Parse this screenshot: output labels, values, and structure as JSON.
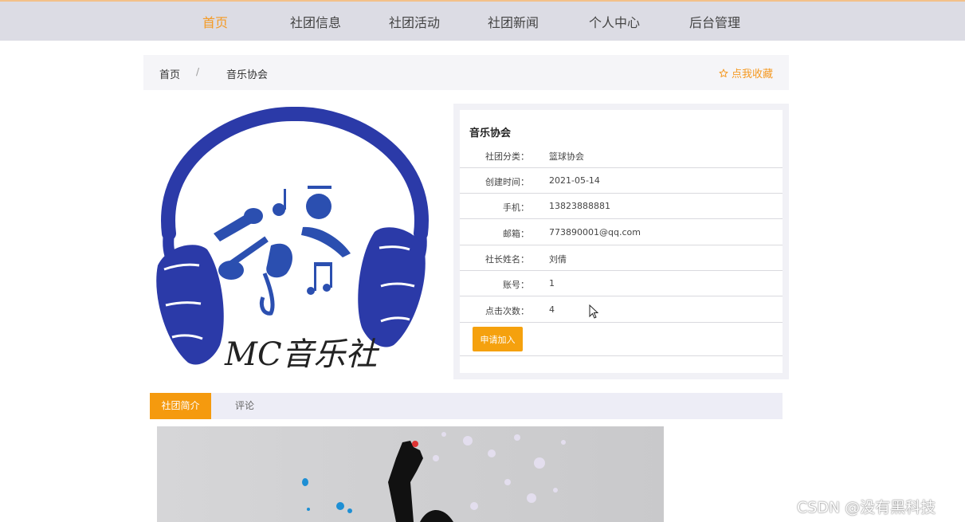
{
  "nav": {
    "items": [
      "首页",
      "社团信息",
      "社团活动",
      "社团新闻",
      "个人中心",
      "后台管理"
    ],
    "active_index": 0
  },
  "breadcrumb": {
    "home": "首页",
    "separator": "/",
    "current": "音乐协会",
    "favorite_icon": "star-outline-icon",
    "favorite": "点我收藏"
  },
  "logo": {
    "text": "MC音乐社",
    "color": "#2b3aa8"
  },
  "club": {
    "name": "音乐协会",
    "fields": [
      {
        "label": "社团分类：",
        "value": "篮球协会"
      },
      {
        "label": "创建时间：",
        "value": "2021-05-14"
      },
      {
        "label": "手机：",
        "value": "13823888881"
      },
      {
        "label": "邮箱：",
        "value": "773890001@qq.com"
      },
      {
        "label": "社长姓名：",
        "value": "刘倩"
      },
      {
        "label": "账号：",
        "value": "1"
      },
      {
        "label": "点击次数：",
        "value": "4"
      }
    ],
    "apply_button": "申请加入"
  },
  "tabs": {
    "items": [
      "社团简介",
      "评论"
    ],
    "active_index": 0
  },
  "colors": {
    "accent": "#f59a23",
    "nav_bg": "#dcdce4",
    "button": "#f5a10e"
  },
  "watermark": "CSDN @没有黑科技"
}
